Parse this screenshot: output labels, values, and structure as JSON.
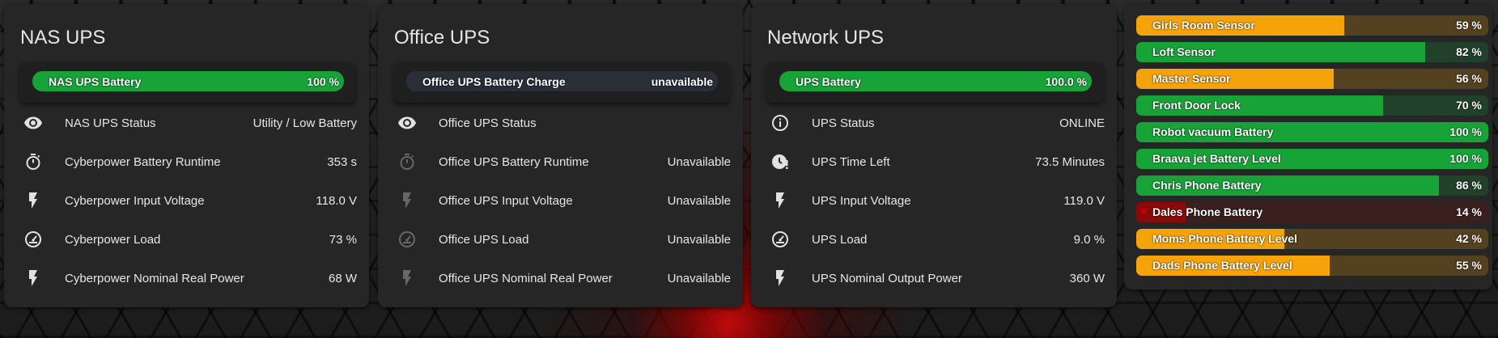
{
  "colors": {
    "green": "#18a339",
    "orange": "#f5a30a",
    "red": "#8a0a0a",
    "track_empty": "#2a2e36"
  },
  "cards": [
    {
      "title": "NAS UPS",
      "battery": {
        "name": "NAS UPS Battery",
        "value": "100 %",
        "level": 1.0,
        "color": "green"
      },
      "rows": [
        {
          "icon": "eye-icon",
          "label": "NAS UPS Status",
          "value": "Utility / Low Battery",
          "dim": false
        },
        {
          "icon": "timer-icon",
          "label": "Cyberpower Battery Runtime",
          "value": "353 s",
          "dim": false
        },
        {
          "icon": "flash-icon",
          "label": "Cyberpower Input Voltage",
          "value": "118.0 V",
          "dim": false
        },
        {
          "icon": "gauge-icon",
          "label": "Cyberpower Load",
          "value": "73 %",
          "dim": false
        },
        {
          "icon": "flash-icon",
          "label": "Cyberpower Nominal Real Power",
          "value": "68 W",
          "dim": false
        }
      ]
    },
    {
      "title": "Office UPS",
      "battery": {
        "name": "Office UPS Battery Charge",
        "value": "unavailable",
        "level": 0,
        "color": "green"
      },
      "rows": [
        {
          "icon": "eye-icon",
          "label": "Office UPS Status",
          "value": "",
          "dim": false
        },
        {
          "icon": "timer-icon",
          "label": "Office UPS Battery Runtime",
          "value": "Unavailable",
          "dim": true
        },
        {
          "icon": "flash-icon",
          "label": "Office UPS Input Voltage",
          "value": "Unavailable",
          "dim": true
        },
        {
          "icon": "gauge-icon",
          "label": "Office UPS Load",
          "value": "Unavailable",
          "dim": true
        },
        {
          "icon": "flash-icon",
          "label": "Office UPS Nominal Real Power",
          "value": "Unavailable",
          "dim": true
        }
      ]
    },
    {
      "title": "Network UPS",
      "battery": {
        "name": "UPS Battery",
        "value": "100.0 %",
        "level": 1.0,
        "color": "green"
      },
      "rows": [
        {
          "icon": "info-icon",
          "label": "UPS Status",
          "value": "ONLINE",
          "dim": false
        },
        {
          "icon": "clock-alert-icon",
          "label": "UPS Time Left",
          "value": "73.5 Minutes",
          "dim": false
        },
        {
          "icon": "flash-icon",
          "label": "UPS Input Voltage",
          "value": "119.0 V",
          "dim": false
        },
        {
          "icon": "gauge-icon",
          "label": "UPS Load",
          "value": "9.0 %",
          "dim": false
        },
        {
          "icon": "flash-icon",
          "label": "UPS Nominal Output Power",
          "value": "360 W",
          "dim": false
        }
      ]
    }
  ],
  "sensors": [
    {
      "name": "Girls Room Sensor",
      "value": "59 %",
      "level": 0.59,
      "color": "orange",
      "low": false
    },
    {
      "name": "Loft Sensor",
      "value": "82 %",
      "level": 0.82,
      "color": "green",
      "low": false
    },
    {
      "name": "Master Sensor",
      "value": "56 %",
      "level": 0.56,
      "color": "orange",
      "low": false
    },
    {
      "name": "Front Door Lock",
      "value": "70 %",
      "level": 0.7,
      "color": "green",
      "low": false
    },
    {
      "name": "Robot vacuum Battery",
      "value": "100 %",
      "level": 1.0,
      "color": "green",
      "low": false
    },
    {
      "name": "Braava jet Battery Level",
      "value": "100 %",
      "level": 1.0,
      "color": "green",
      "low": false
    },
    {
      "name": "Chris Phone Battery",
      "value": "86 %",
      "level": 0.86,
      "color": "green",
      "low": false
    },
    {
      "name": "Dales Phone Battery",
      "value": "14 %",
      "level": 0.14,
      "color": "red",
      "low": true
    },
    {
      "name": "Moms Phone Battery Level",
      "value": "42 %",
      "level": 0.42,
      "color": "orange",
      "low": false
    },
    {
      "name": "Dads Phone Battery Level",
      "value": "55 %",
      "level": 0.55,
      "color": "orange",
      "low": false
    }
  ]
}
